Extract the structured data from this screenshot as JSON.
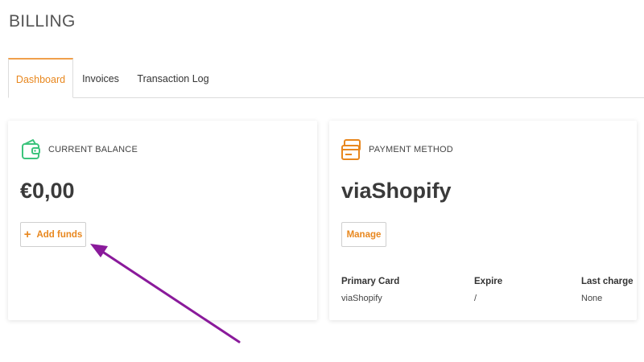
{
  "page": {
    "title": "BILLING"
  },
  "tabs": [
    {
      "label": "Dashboard",
      "active": true
    },
    {
      "label": "Invoices",
      "active": false
    },
    {
      "label": "Transaction Log",
      "active": false
    }
  ],
  "balance_card": {
    "label": "CURRENT BALANCE",
    "icon": "wallet-icon",
    "value": "€0,00",
    "add_funds_label": "Add funds"
  },
  "payment_card": {
    "label": "PAYMENT METHOD",
    "icon": "credit-card-icon",
    "value": "viaShopify",
    "manage_label": "Manage",
    "table": {
      "headers": [
        "Primary Card",
        "Expire",
        "Last charge"
      ],
      "row": [
        "viaShopify",
        "/",
        "None"
      ]
    }
  },
  "colors": {
    "accent": "#e8871e",
    "wallet_icon": "#3cc47c",
    "card_icon": "#e8871e",
    "arrow": "#8a1a9b"
  }
}
